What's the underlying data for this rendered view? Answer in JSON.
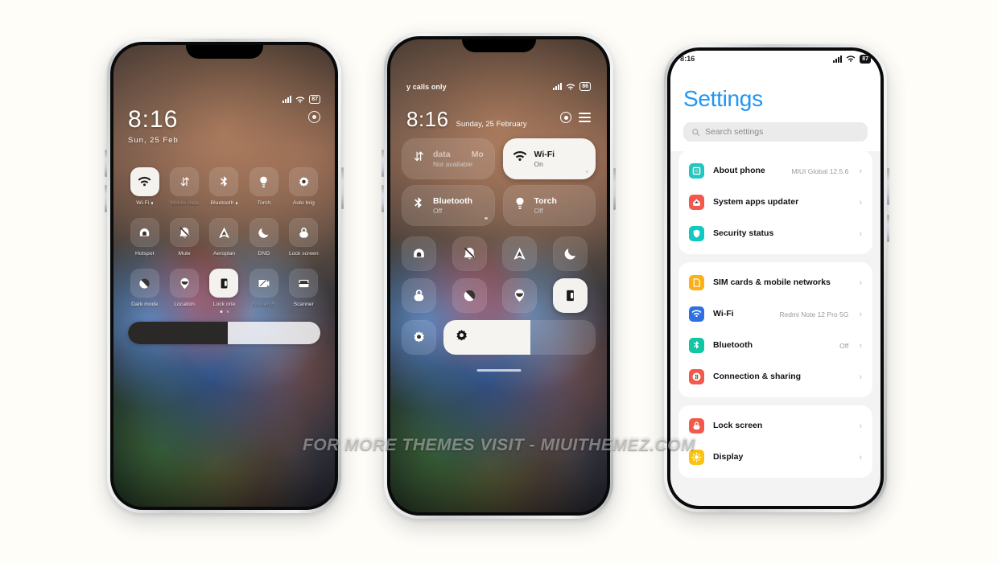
{
  "background_color": "#fefdf8",
  "watermark": {
    "text": "FOR MORE THEMES VISIT - MIUITHEMEZ.COM"
  },
  "phone1": {
    "status": {
      "time": "8:16",
      "date": "Sun, 25 Feb",
      "battery": "87",
      "signal_icon": "signal-bars-icon",
      "wifi_icon": "wifi-icon",
      "settings_icon": "settings-gear-icon"
    },
    "tiles": [
      {
        "label": "Wi-Fi",
        "icon": "wifi-icon",
        "on": true,
        "dot": true,
        "dim": false
      },
      {
        "label": "Mobile data",
        "icon": "data-transfer-icon",
        "on": false,
        "dot": false,
        "dim": true
      },
      {
        "label": "Bluetooth",
        "icon": "bluetooth-icon",
        "on": false,
        "dot": true,
        "dim": false
      },
      {
        "label": "Torch",
        "icon": "torch-icon",
        "on": false,
        "dot": false,
        "dim": false
      },
      {
        "label": "Auto brig",
        "icon": "auto-brightness-icon",
        "on": false,
        "dot": false,
        "dim": false
      },
      {
        "label": "Hotspot",
        "icon": "hotspot-icon",
        "on": false,
        "dot": false,
        "dim": false
      },
      {
        "label": "Mute",
        "icon": "mute-bell-icon",
        "on": false,
        "dot": false,
        "dim": false
      },
      {
        "label": "Aeroplan",
        "icon": "aeroplane-icon",
        "on": false,
        "dot": false,
        "dim": false
      },
      {
        "label": "DND",
        "icon": "moon-dnd-icon",
        "on": false,
        "dot": false,
        "dim": false
      },
      {
        "label": "Lock screen",
        "icon": "lock-icon",
        "on": false,
        "dot": false,
        "dim": false
      },
      {
        "label": "Dark mode",
        "icon": "dark-mode-icon",
        "on": false,
        "dot": false,
        "dim": false
      },
      {
        "label": "Location",
        "icon": "location-pin-icon",
        "on": false,
        "dot": false,
        "dim": false
      },
      {
        "label": "Lock orie",
        "icon": "lock-orientation-icon",
        "on": true,
        "dot": false,
        "dim": false
      },
      {
        "label": "Screen R",
        "icon": "screen-record-icon",
        "on": false,
        "dot": false,
        "dim": true
      },
      {
        "label": "Scanner",
        "icon": "scanner-icon",
        "on": false,
        "dot": false,
        "dim": false
      }
    ],
    "page_dots": [
      true,
      false
    ],
    "brightness_percent": 52
  },
  "phone2": {
    "status": {
      "carrier": "y calls only",
      "battery": "86",
      "signal_icon": "signal-bars-icon",
      "wifi_icon": "wifi-icon"
    },
    "clock": {
      "time": "8:16",
      "date": "Sunday, 25 February"
    },
    "header_icons": [
      "settings-gear-icon",
      "menu-lines-icon"
    ],
    "big_tiles": [
      {
        "name": "data",
        "name2": "Mo",
        "sub": "Not available",
        "icon": "data-transfer-icon",
        "on": false,
        "dot": false,
        "truncated": true
      },
      {
        "name": "Wi-Fi",
        "sub": "On",
        "icon": "wifi-icon",
        "on": true,
        "dot": true
      },
      {
        "name": "Bluetooth",
        "sub": "Off",
        "icon": "bluetooth-icon",
        "on": false,
        "dot": true
      },
      {
        "name": "Torch",
        "sub": "Off",
        "icon": "torch-icon",
        "on": false,
        "dot": false
      }
    ],
    "small_tiles": [
      {
        "icon": "hotspot-icon",
        "on": false
      },
      {
        "icon": "mute-bell-icon",
        "on": false
      },
      {
        "icon": "aeroplane-icon",
        "on": false
      },
      {
        "icon": "moon-dnd-icon",
        "on": false
      },
      {
        "icon": "lock-icon",
        "on": false
      },
      {
        "icon": "dark-mode-icon",
        "on": false
      },
      {
        "icon": "location-pin-icon",
        "on": false
      },
      {
        "icon": "lock-orientation-icon",
        "on": true
      }
    ],
    "brightness": {
      "icon": "auto-brightness-icon",
      "slider_icon": "brightness-icon",
      "percent": 57
    }
  },
  "phone3": {
    "status": {
      "time": "8:16",
      "battery": "87",
      "signal_icon": "signal-bars-icon",
      "wifi_icon": "wifi-icon"
    },
    "title": "Settings",
    "title_color": "#2196f3",
    "search": {
      "placeholder": "Search settings",
      "icon": "search-icon"
    },
    "groups": [
      {
        "rows": [
          {
            "label": "About phone",
            "value": "MIUI Global 12.5.6",
            "icon": "about-phone-icon",
            "color": "#1fc8c0"
          },
          {
            "label": "System apps updater",
            "value": "",
            "icon": "system-updater-icon",
            "color": "#f2594b"
          },
          {
            "label": "Security status",
            "value": "",
            "icon": "security-shield-icon",
            "color": "#12c9c1"
          }
        ]
      },
      {
        "rows": [
          {
            "label": "SIM cards & mobile networks",
            "value": "",
            "icon": "sim-card-icon",
            "color": "#fbb017"
          },
          {
            "label": "Wi-Fi",
            "value": "Redmi Note 12 Pro 5G",
            "icon": "wifi-icon",
            "color": "#2f6fe4"
          },
          {
            "label": "Bluetooth",
            "value": "Off",
            "icon": "bluetooth-icon",
            "color": "#0fc6a5"
          },
          {
            "label": "Connection & sharing",
            "value": "",
            "icon": "connection-sharing-icon",
            "color": "#f2594b"
          }
        ]
      },
      {
        "rows": [
          {
            "label": "Lock screen",
            "value": "",
            "icon": "lock-icon",
            "color": "#f2594b"
          },
          {
            "label": "Display",
            "value": "",
            "icon": "display-sun-icon",
            "color": "#fac312"
          }
        ]
      }
    ],
    "chevron": "›"
  }
}
